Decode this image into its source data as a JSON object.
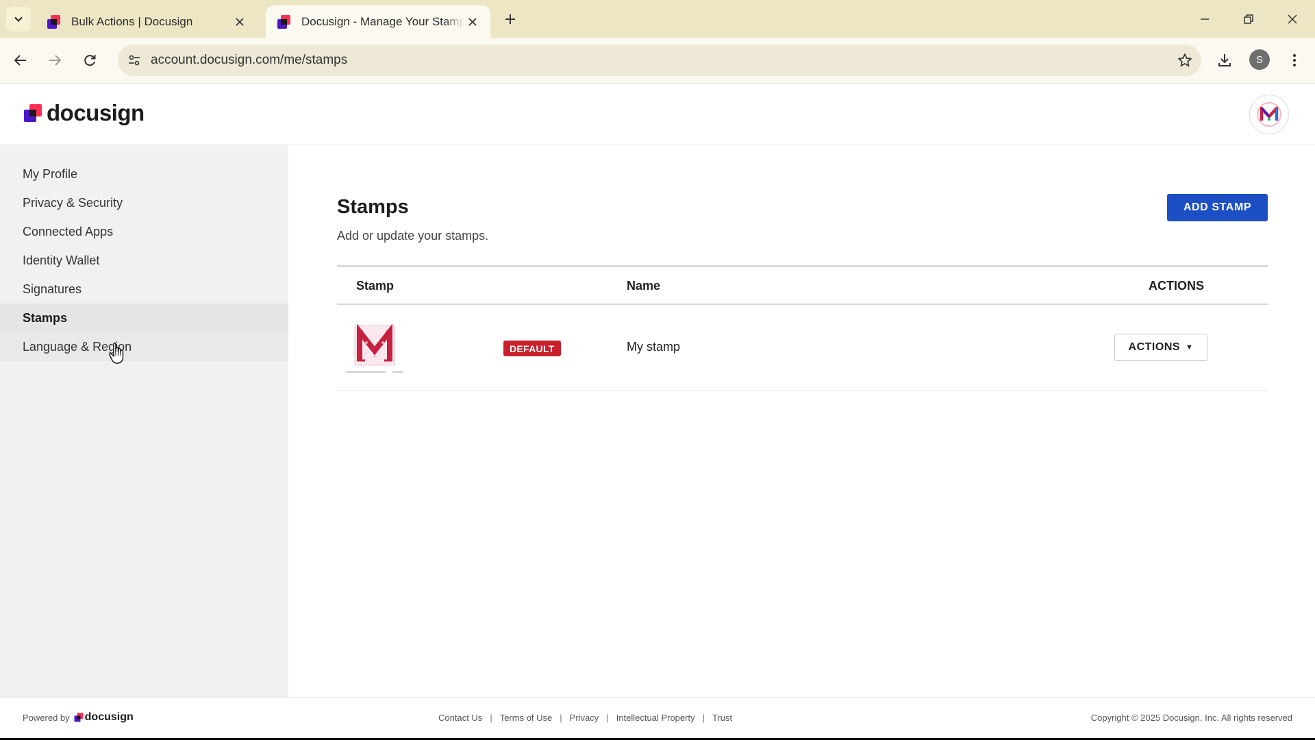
{
  "browser": {
    "tabs": [
      {
        "title": "Bulk Actions | Docusign",
        "active": false
      },
      {
        "title": "Docusign - Manage Your Stamps",
        "active": true
      }
    ],
    "url": "account.docusign.com/me/stamps",
    "profile_initial": "S"
  },
  "header": {
    "logo_text": "docusign",
    "avatar_letter": "M"
  },
  "sidebar": {
    "items": [
      {
        "label": "My Profile"
      },
      {
        "label": "Privacy & Security"
      },
      {
        "label": "Connected Apps"
      },
      {
        "label": "Identity Wallet"
      },
      {
        "label": "Signatures"
      },
      {
        "label": "Stamps",
        "selected": true
      },
      {
        "label": "Language & Region",
        "hovered": true
      }
    ]
  },
  "main": {
    "title": "Stamps",
    "subtitle": "Add or update your stamps.",
    "add_button": "ADD STAMP",
    "table": {
      "headers": {
        "stamp": "Stamp",
        "name": "Name",
        "actions": "ACTIONS"
      },
      "rows": [
        {
          "stamp_letter": "M",
          "badge": "DEFAULT",
          "name": "My stamp",
          "action_label": "ACTIONS"
        }
      ]
    }
  },
  "footer": {
    "powered_by": "Powered by",
    "powered_logo": "docusign",
    "links": [
      "Contact Us",
      "Terms of Use",
      "Privacy",
      "Intellectual Property",
      "Trust"
    ],
    "copyright": "Copyright © 2025 Docusign, Inc. All rights reserved"
  },
  "colors": {
    "primary_button": "#1d4fc4",
    "default_badge": "#c9202c",
    "browser_frame": "#ece6c5",
    "sidebar_bg": "#f1f1f1",
    "stamp_red": "#c8203f"
  }
}
